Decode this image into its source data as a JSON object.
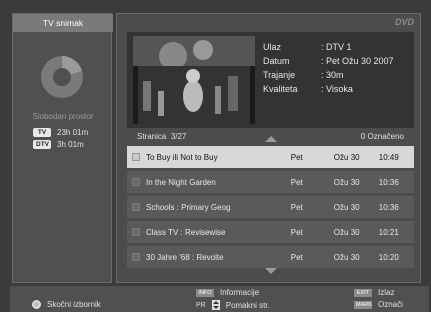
{
  "left": {
    "tab_label": "TV snimak",
    "free_space_label": "Slobodan prostor",
    "times": [
      {
        "badge": "TV",
        "value": "23h 01m"
      },
      {
        "badge": "DTV",
        "value": "3h 01m"
      }
    ]
  },
  "header": {
    "logo": "DVD"
  },
  "info": {
    "rows": [
      {
        "key": "Ulaz",
        "value": ": DTV 1"
      },
      {
        "key": "Datum",
        "value": ": Pet Ožu 30 2007"
      },
      {
        "key": "Trajanje",
        "value": ": 30m"
      },
      {
        "key": "Kvaliteta",
        "value": ": Visoka"
      }
    ]
  },
  "page": {
    "label": "Stranica",
    "current": "3/27",
    "marked": "0 Označeno"
  },
  "recordings": [
    {
      "title": "To Buy ili Not to Buy",
      "day": "Pet",
      "date": "Ožu 30",
      "time": "10:49",
      "selected": true
    },
    {
      "title": "In the Night Garden",
      "day": "Pet",
      "date": "Ožu 30",
      "time": "10:36",
      "selected": false
    },
    {
      "title": "Schools : Primary Geog",
      "day": "Pet",
      "date": "Ožu 30",
      "time": "10:36",
      "selected": false
    },
    {
      "title": "Class TV : Revisewise",
      "day": "Pet",
      "date": "Ožu 30",
      "time": "10:21",
      "selected": false
    },
    {
      "title": "30 Jahre '68 : Revolte",
      "day": "Pet",
      "date": "Ožu 30",
      "time": "10:20",
      "selected": false
    }
  ],
  "bottom": {
    "popup_label": "Skočni izbornik",
    "info_key": "INFO",
    "info_label": "Informacije",
    "pr_key": "PR",
    "page_move_label": "Pomakni str.",
    "exit_key": "EXIT",
    "exit_label": "Izlaz",
    "mark_key": "MARK",
    "mark_label": "Označi"
  }
}
